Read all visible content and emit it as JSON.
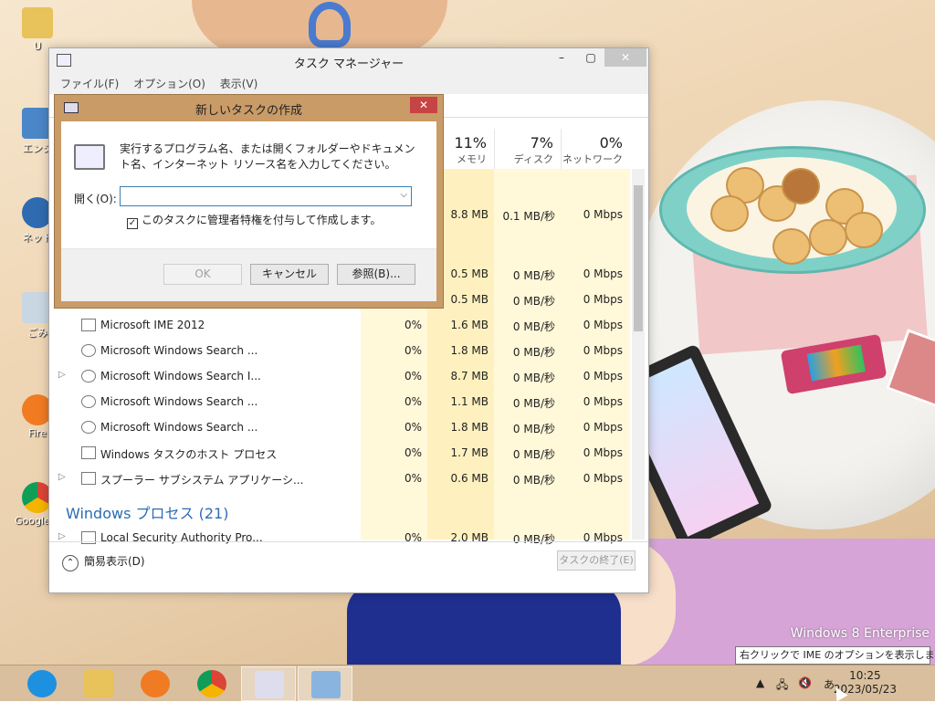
{
  "taskmanager": {
    "title": "タスク マネージャー",
    "menu": [
      "ファイル(F)",
      "オプション(O)",
      "表示(V)"
    ],
    "columns": [
      {
        "pct": "11%",
        "label": "メモリ"
      },
      {
        "pct": "7%",
        "label": "ディスク"
      },
      {
        "pct": "0%",
        "label": "ネットワーク"
      }
    ],
    "rows": [
      {
        "name": "",
        "cpu": "",
        "mem": "8.8 MB",
        "disk": "0.1 MB/秒",
        "net": "0 Mbps"
      },
      {
        "name": "",
        "cpu": "",
        "mem": "0.5 MB",
        "disk": "0 MB/秒",
        "net": "0 Mbps"
      },
      {
        "name": "",
        "cpu": "",
        "mem": "0.5 MB",
        "disk": "0 MB/秒",
        "net": "0 Mbps"
      },
      {
        "name": "Microsoft IME 2012",
        "cpu": "0%",
        "mem": "1.6 MB",
        "disk": "0 MB/秒",
        "net": "0 Mbps"
      },
      {
        "name": "Microsoft Windows Search ...",
        "cpu": "0%",
        "mem": "1.8 MB",
        "disk": "0 MB/秒",
        "net": "0 Mbps"
      },
      {
        "name": "Microsoft Windows Search I...",
        "cpu": "0%",
        "mem": "8.7 MB",
        "disk": "0 MB/秒",
        "net": "0 Mbps"
      },
      {
        "name": "Microsoft Windows Search ...",
        "cpu": "0%",
        "mem": "1.1 MB",
        "disk": "0 MB/秒",
        "net": "0 Mbps"
      },
      {
        "name": "Microsoft Windows Search ...",
        "cpu": "0%",
        "mem": "1.8 MB",
        "disk": "0 MB/秒",
        "net": "0 Mbps"
      },
      {
        "name": "Windows タスクのホスト プロセス",
        "cpu": "0%",
        "mem": "1.7 MB",
        "disk": "0 MB/秒",
        "net": "0 Mbps"
      },
      {
        "name": "スプーラー サブシステム アプリケーシ...",
        "cpu": "0%",
        "mem": "0.6 MB",
        "disk": "0 MB/秒",
        "net": "0 Mbps"
      },
      {
        "name": "Local Security Authority Pro...",
        "cpu": "0%",
        "mem": "2.0 MB",
        "disk": "0 MB/秒",
        "net": "0 Mbps"
      }
    ],
    "group_title": "Windows プロセス (21)",
    "fewer_details": "簡易表示(D)",
    "end_task": "タスクの終了(E)"
  },
  "dialog": {
    "title": "新しいタスクの作成",
    "description": "実行するプログラム名、または開くフォルダーやドキュメント名、インターネット リソース名を入力してください。",
    "open_label": "開く(O):",
    "open_value": "",
    "checkbox_label": "このタスクに管理者特権を付与して作成します。",
    "checkbox_checked": true,
    "ok": "OK",
    "cancel": "キャンセル",
    "browse": "参照(B)..."
  },
  "desktop": {
    "icons": [
      "U",
      "エンジ",
      "ネット",
      "ごみ",
      "Fire",
      "Google C"
    ],
    "edition": "Windows 8 Enterprise"
  },
  "taskbar": {
    "tooltip": "右クリックで IME のオプションを表示します。",
    "ime": "あ",
    "time": "10:25",
    "date": "2023/05/23"
  }
}
